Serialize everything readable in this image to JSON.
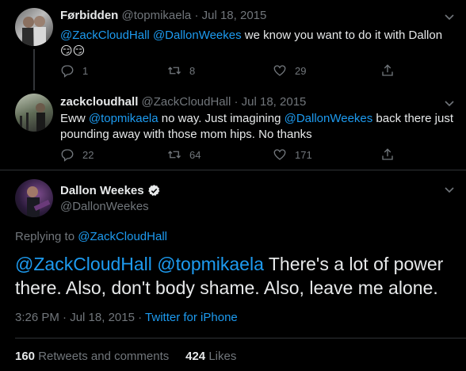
{
  "tweets": [
    {
      "display_name": "Førbidden",
      "handle": "@topmikaela",
      "sep": "·",
      "date": "Jul 18, 2015",
      "text_parts": [
        {
          "text": "@ZackCloudHall",
          "link": true
        },
        {
          "text": " ",
          "link": false
        },
        {
          "text": "@DallonWeekes",
          "link": true
        },
        {
          "text": " we know you want to do it with Dallon 😏😏",
          "link": false
        }
      ],
      "reply_count": "1",
      "retweet_count": "8",
      "like_count": "29"
    },
    {
      "display_name": "zackcloudhall",
      "handle": "@ZackCloudHall",
      "sep": "·",
      "date": "Jul 18, 2015",
      "text_parts": [
        {
          "text": "Eww ",
          "link": false
        },
        {
          "text": "@topmikaela",
          "link": true
        },
        {
          "text": " no way. Just imagining ",
          "link": false
        },
        {
          "text": "@DallonWeekes",
          "link": true
        },
        {
          "text": " back there just pounding away with those mom hips. No thanks",
          "link": false
        }
      ],
      "reply_count": "22",
      "retweet_count": "64",
      "like_count": "171"
    }
  ],
  "main": {
    "display_name": "Dallon Weekes",
    "handle": "@DallonWeekes",
    "replying_label": "Replying to",
    "replying_to": "@ZackCloudHall",
    "mention1": "@ZackCloudHall",
    "mention2": "@topmikaela",
    "body": " There's a lot of power there. Also, don't body shame. Also, leave me alone.",
    "time": "3:26 PM",
    "sep": "·",
    "date": "Jul 18, 2015",
    "source": "Twitter for iPhone",
    "retweets_count": "160",
    "retweets_label": "Retweets and comments",
    "likes_count": "424",
    "likes_label": "Likes"
  },
  "colors": {
    "background": "#000000",
    "link": "#1d9bf0",
    "muted": "#71767b",
    "text": "#e7e9ea",
    "verified": "#e7e9ea"
  },
  "icons": [
    "reply-icon",
    "retweet-icon",
    "like-icon",
    "share-icon",
    "chevron-down-icon",
    "verified-icon"
  ]
}
